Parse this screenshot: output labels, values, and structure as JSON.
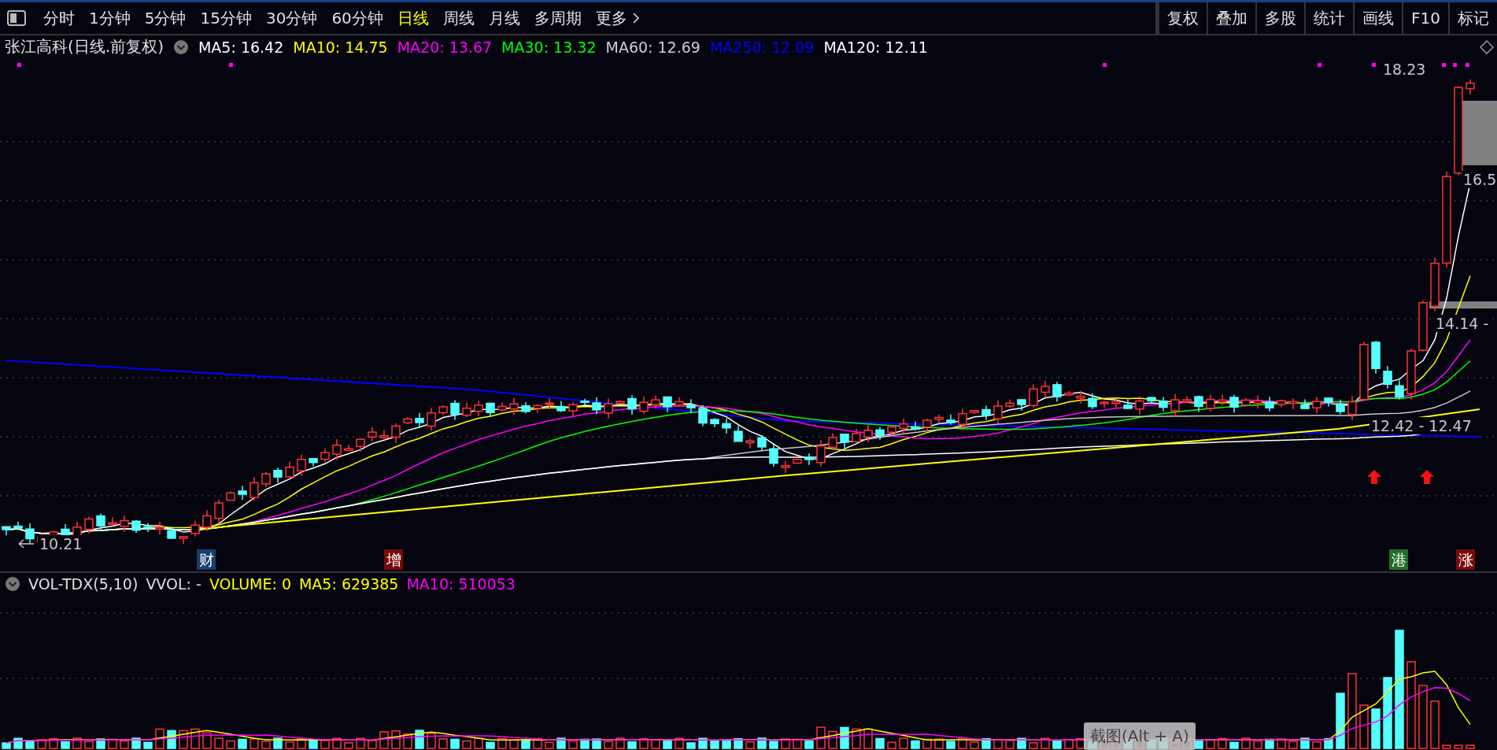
{
  "toolbar": {
    "tabs": [
      {
        "label": "分时",
        "selected": false
      },
      {
        "label": "1分钟",
        "selected": false
      },
      {
        "label": "5分钟",
        "selected": false
      },
      {
        "label": "15分钟",
        "selected": false
      },
      {
        "label": "30分钟",
        "selected": false
      },
      {
        "label": "60分钟",
        "selected": false
      },
      {
        "label": "日线",
        "selected": true
      },
      {
        "label": "周线",
        "selected": false
      },
      {
        "label": "月线",
        "selected": false
      },
      {
        "label": "多周期",
        "selected": false
      }
    ],
    "more": "更多",
    "buttons": [
      "复权",
      "叠加",
      "多股",
      "统计",
      "画线",
      "F10",
      "标记"
    ]
  },
  "header": {
    "stock": "张江高科(日线.前复权)",
    "indicators": [
      {
        "label": "MA5: 16.42",
        "color": "#ffffff"
      },
      {
        "label": "MA10: 14.75",
        "color": "#ffff00"
      },
      {
        "label": "MA20: 13.67",
        "color": "#ff00ff"
      },
      {
        "label": "MA30: 13.32",
        "color": "#00ff00"
      },
      {
        "label": "MA60: 12.69",
        "color": "#d0d0d0"
      },
      {
        "label": "MA250: 12.09",
        "color": "#0000ff"
      },
      {
        "label": "MA120: 12.11",
        "color": "#ffffff"
      }
    ]
  },
  "chart": {
    "price_labels": [
      "18.23",
      "16.5",
      "14.14 -",
      "12.42 - 12.47",
      "10.21"
    ],
    "events": [
      {
        "label": "财",
        "color": "#1a3d6e"
      },
      {
        "label": "增",
        "color": "#7a0a0a"
      },
      {
        "label": "港",
        "color": "#1f6e2a"
      },
      {
        "label": "涨",
        "color": "#7a0a0a"
      }
    ]
  },
  "volume": {
    "title": "VOL-TDX(5,10)",
    "indicators": [
      {
        "label": "VVOL: -",
        "color": "#e0e0e0"
      },
      {
        "label": "VOLUME: 0",
        "color": "#ffff00"
      },
      {
        "label": "MA5: 629385",
        "color": "#ffff00"
      },
      {
        "label": "MA10: 510053",
        "color": "#ff00ff"
      }
    ]
  },
  "tooltip": "截图(Alt + A)"
}
